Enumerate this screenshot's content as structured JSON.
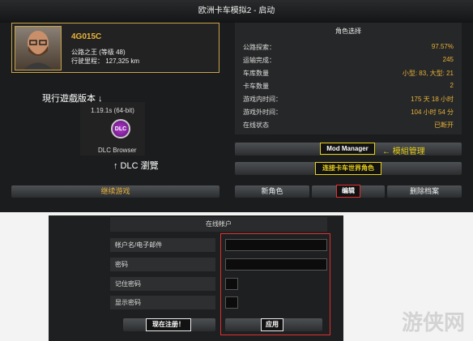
{
  "window": {
    "title": "欧洲卡车模拟2 - 启动"
  },
  "profile": {
    "name": "4G015C",
    "rank": "公路之王 (等级 48)",
    "mileage": "行驶里程： 127,325 km"
  },
  "version": {
    "note": "現行遊戲版本 ↓",
    "label": "1.19.1s (64-bit)",
    "dlc_badge": "DLC",
    "dlc_label": "DLC Browser",
    "dlc_note": "↑ DLC 瀏覽"
  },
  "continue_button": "继续游戏",
  "stats_panel": {
    "title": "角色选择",
    "rows": [
      {
        "label": "公路探索：",
        "value": "97.57%"
      },
      {
        "label": "运输完成：",
        "value": "245"
      },
      {
        "label": "车库数量",
        "value": "小型: 83, 大型: 21"
      },
      {
        "label": "卡车数量",
        "value": "2"
      },
      {
        "label": "游戏内时间：",
        "value": "175 天 18 小时"
      },
      {
        "label": "游戏外时间：",
        "value": "104 小时 54 分"
      },
      {
        "label": "在线状态",
        "value": "已断开"
      }
    ]
  },
  "mod_manager": {
    "label": "Mod Manager",
    "note": "← 模組管理"
  },
  "connect_button": "连接卡车世界角色",
  "actions": {
    "new": "新角色",
    "edit": "编辑",
    "delete": "删除档案"
  },
  "account": {
    "title": "在线帐户",
    "labels": [
      "帐户名/电子邮件",
      "密码",
      "记住密码",
      "显示密码"
    ],
    "register": "现在注册！",
    "apply": "应用"
  },
  "watermark": "游侠网",
  "colors": {
    "accent": "#e8b23a",
    "highlight_yellow": "#e8cf1a",
    "highlight_red": "#e03030"
  }
}
